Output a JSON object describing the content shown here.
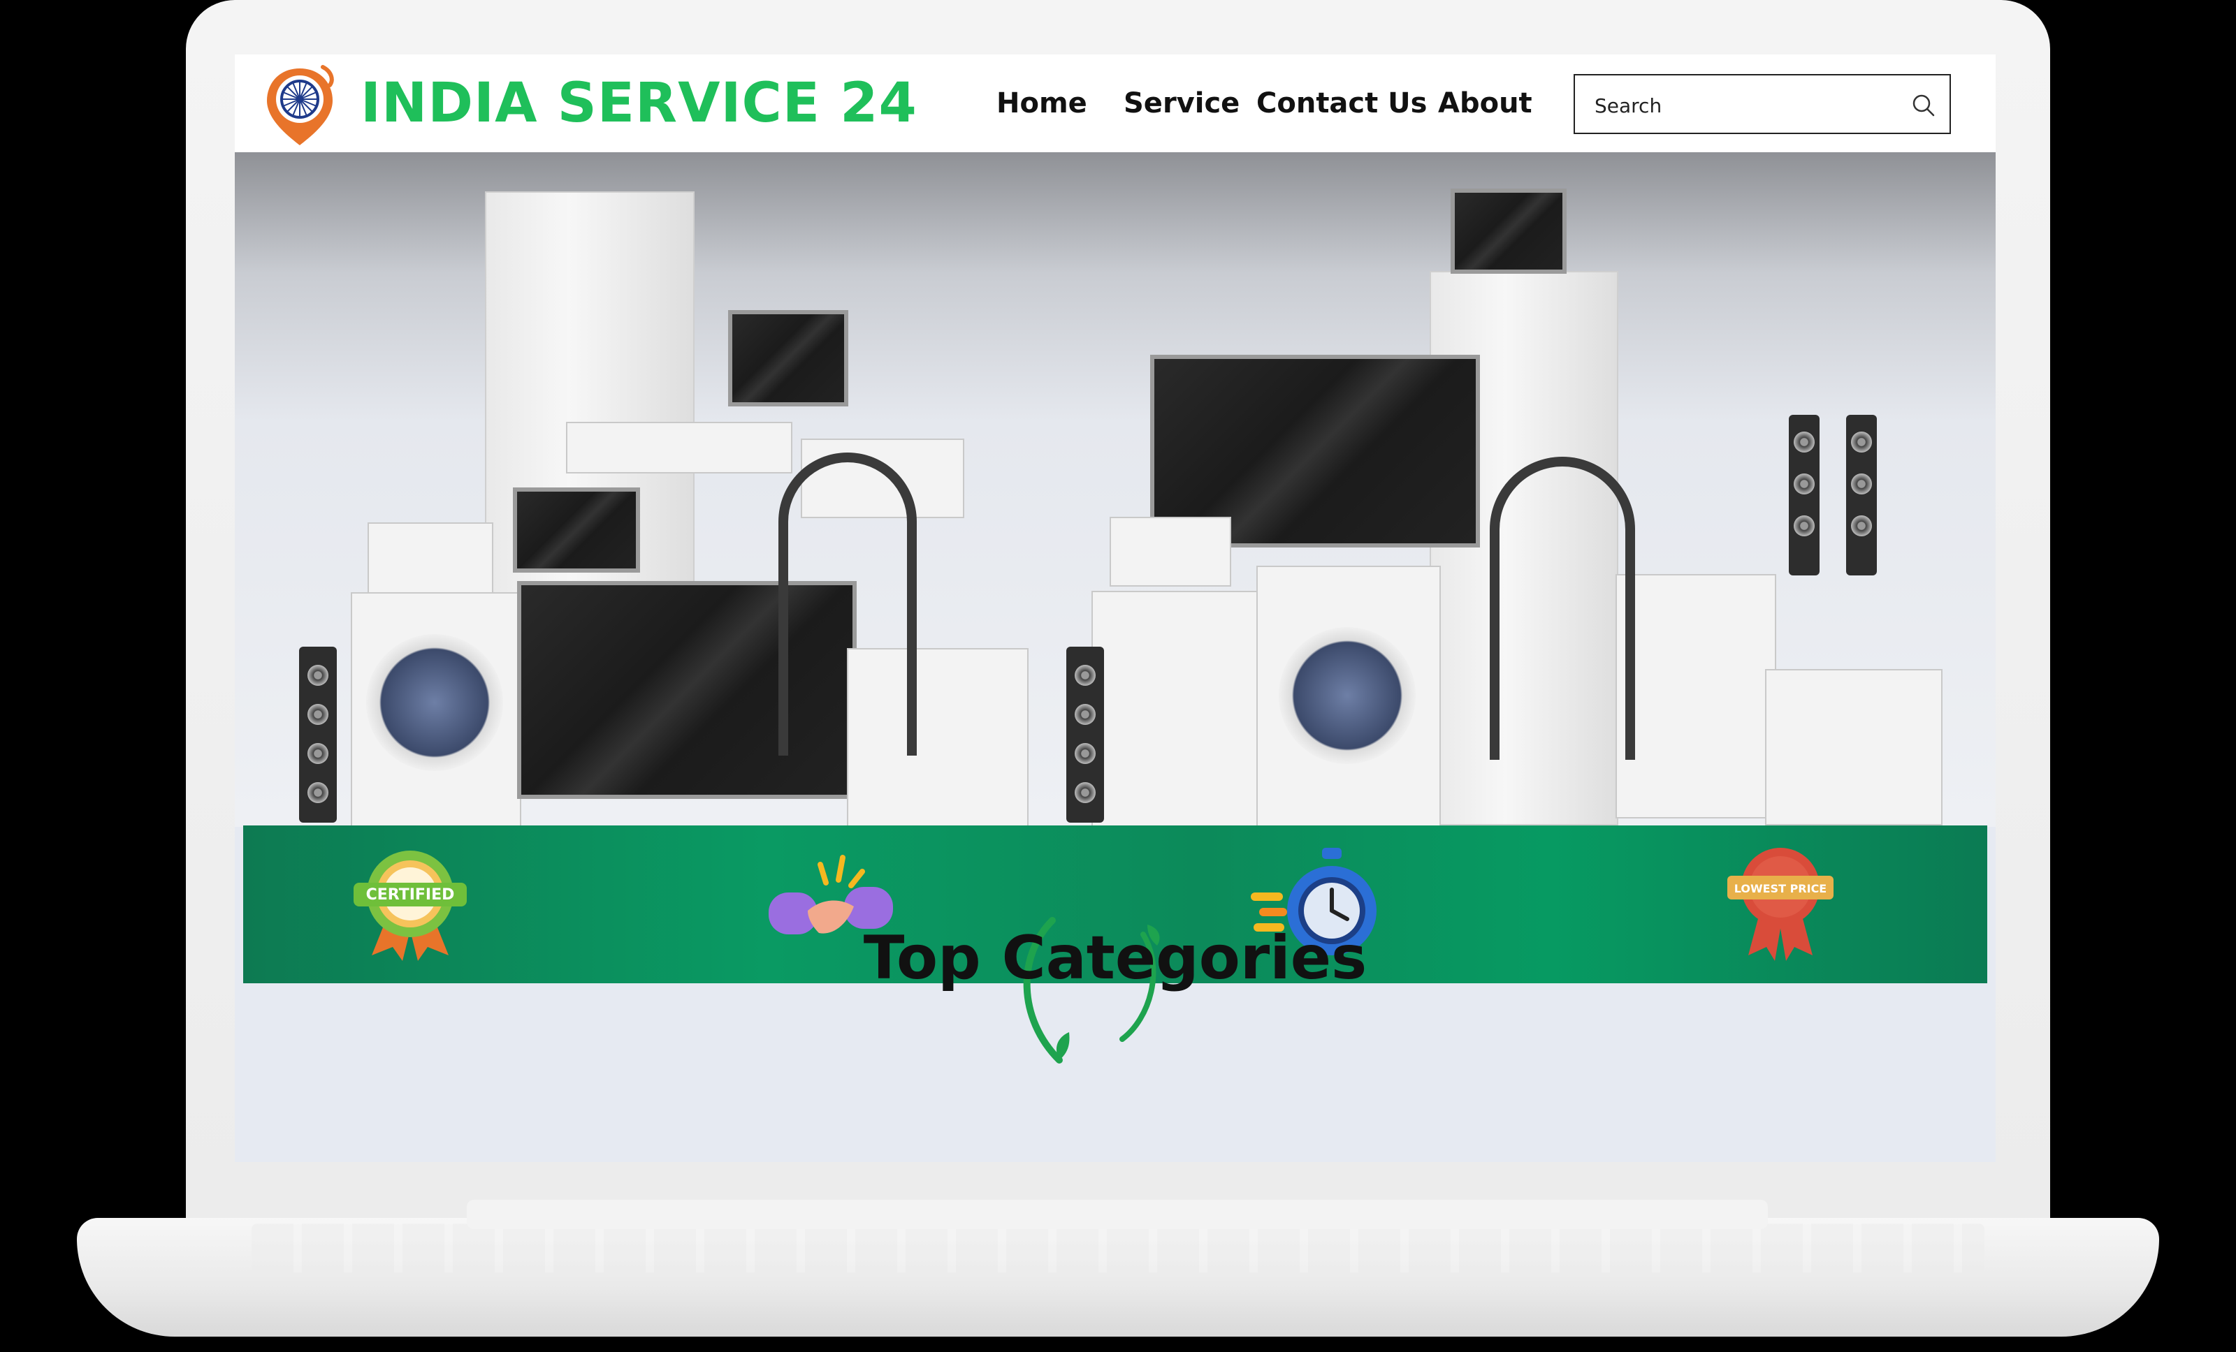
{
  "brand": {
    "name": "INDIA SERVICE 24"
  },
  "nav": {
    "items": [
      {
        "label": "Home"
      },
      {
        "label": "Service"
      },
      {
        "label": "Contact Us"
      },
      {
        "label": "About"
      }
    ]
  },
  "search": {
    "placeholder": "Search",
    "icon": "search-icon"
  },
  "features": [
    {
      "icon": "certified-badge-icon",
      "label": "CERTIFIED"
    },
    {
      "icon": "handshake-icon"
    },
    {
      "icon": "stopwatch-icon"
    },
    {
      "icon": "lowest-price-badge-icon",
      "label": "LOWEST PRICE"
    }
  ],
  "section": {
    "title": "Top Categories"
  },
  "colors": {
    "brand_green": "#1fbf5a",
    "band_green": "#0a9a63"
  }
}
